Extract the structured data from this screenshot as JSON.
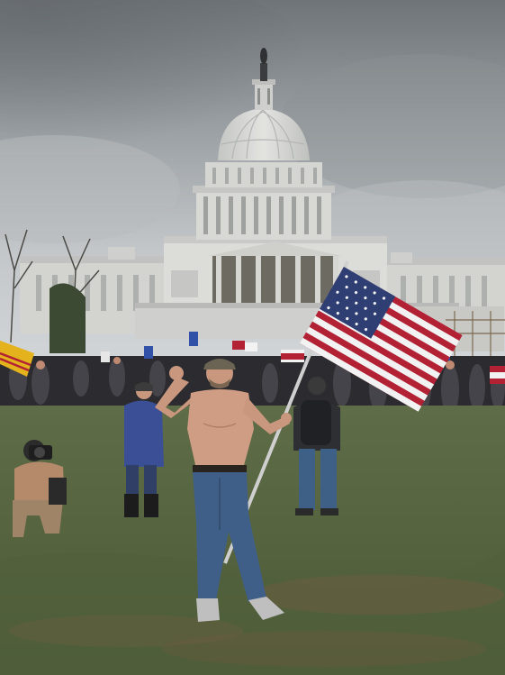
{
  "image": {
    "description_tags": [
      "sky-overcast",
      "capitol-building",
      "crowd",
      "lawn",
      "man-with-flag",
      "photographer",
      "bystander",
      "american-flag",
      "yellow-flag"
    ],
    "palette": {
      "sky_top": "#6f7478",
      "sky_mid": "#a9aeb2",
      "sky_low": "#c9cdd0",
      "building": "#d9d9d6",
      "building_shadow": "#b4b6b4",
      "grass_far": "#5c6b45",
      "grass_near": "#4e5c39",
      "mud": "#6f5e43",
      "skin": "#c9977d",
      "jeans": "#3f5f88",
      "flag_red": "#b22234",
      "flag_white": "#f2f2f2",
      "flag_blue": "#2f3f74",
      "yellow_flag": "#e3b21c",
      "jacket_blue": "#3a4f95"
    }
  }
}
